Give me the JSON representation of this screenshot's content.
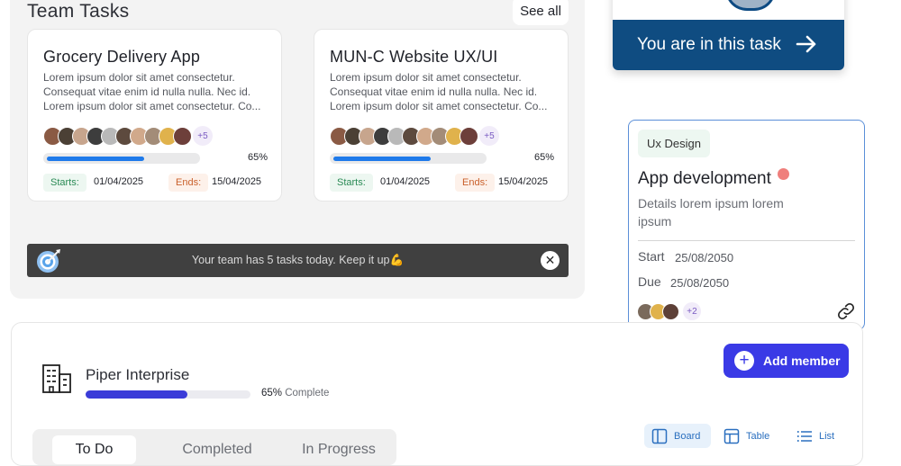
{
  "team": {
    "title": "Team Tasks",
    "see_all": "See all",
    "cards": [
      {
        "title": "Grocery Delivery App",
        "description": [
          "Lorem ipsum dolor sit amet consectetur.",
          "Consequat vitae enim id nulla nulla. Nec id.",
          "Lorem ipsum dolor sit amet consectetur. Co..."
        ],
        "extra_members": "+5",
        "progress": 0.65,
        "progress_label": "65%",
        "starts_label": "Starts:",
        "start_date": "01/04/2025",
        "ends_label": "Ends:",
        "end_date": "15/04/2025"
      },
      {
        "title": "MUN-C Website UX/UI",
        "description": [
          "Lorem ipsum dolor sit amet consectetur.",
          "Consequat vitae enim id nulla nulla. Nec id.",
          "Lorem ipsum dolor sit amet consectetur. Co..."
        ],
        "extra_members": "+5",
        "progress": 0.65,
        "progress_label": "65%",
        "starts_label": "Starts:",
        "start_date": "01/04/2025",
        "ends_label": "Ends:",
        "end_date": "15/04/2025"
      }
    ],
    "banner_text": "Your team has 5 tasks today. Keep it up💪",
    "banner_close": "✕"
  },
  "current_task": {
    "cta_label": "You are in this task"
  },
  "app_card": {
    "tag": "Ux Design",
    "title": "App development",
    "details": "Details lorem ipsum lorem ipsum",
    "start_label": "Start",
    "start_date": "25/08/2050",
    "due_label": "Due",
    "due_date": "25/08/2050",
    "extra_members": "+2"
  },
  "project": {
    "name": "Piper Interprise",
    "progress": 0.65,
    "progress_pct": "65%",
    "progress_word": "Complete",
    "add_member_label": "Add member",
    "tabs": [
      "To Do",
      "Completed",
      "In Progress"
    ],
    "views": [
      "Board",
      "Table",
      "List"
    ]
  },
  "icons": [
    "target-icon",
    "close-icon",
    "arrow-right-icon",
    "link-icon",
    "building-icon",
    "plus-icon",
    "board-icon",
    "table-icon",
    "list-icon"
  ],
  "colors": {
    "primary_blue": "#1f7aea",
    "navy": "#0f4c81",
    "accent_indigo": "#3a3ae6",
    "banner_dark": "#404040"
  }
}
